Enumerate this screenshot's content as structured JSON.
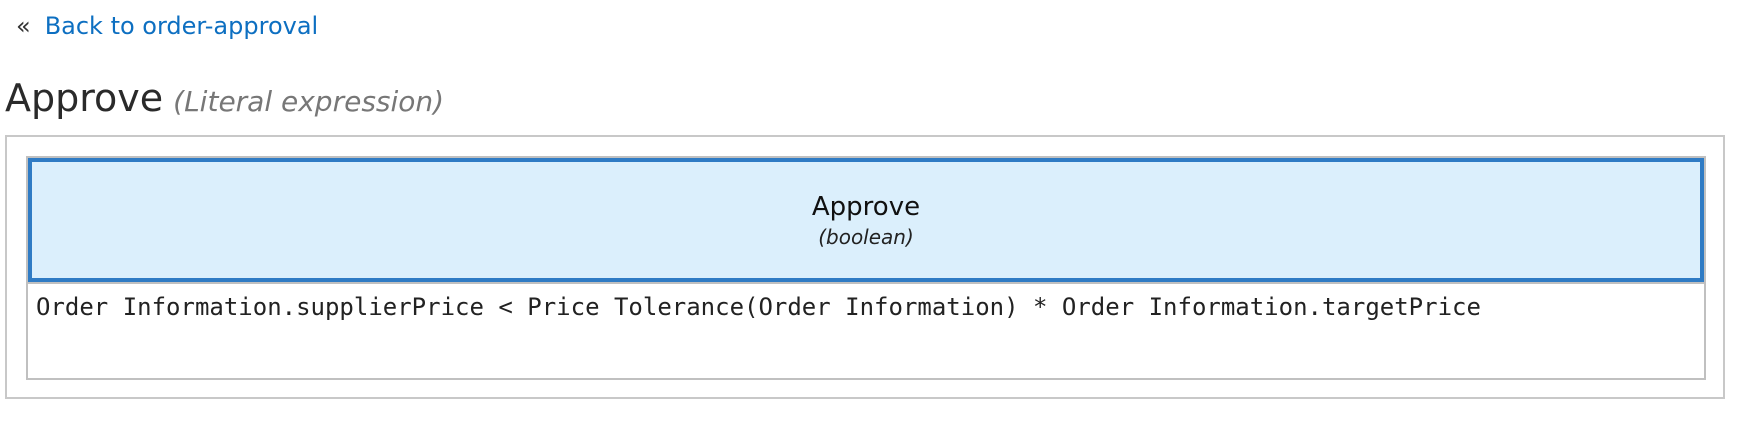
{
  "nav": {
    "back_icon": "«",
    "back_icon_name": "double-chevron-left-icon",
    "back_label": "Back to order-approval"
  },
  "heading": {
    "title": "Approve",
    "subtitle": "(Literal expression)"
  },
  "decision": {
    "name": "Approve",
    "type": "(boolean)",
    "expression": "Order Information.supplierPrice < Price Tolerance(Order Information) * Order Information.targetPrice"
  },
  "colors": {
    "link": "#0d6fc1",
    "header_fill": "#dbeffc",
    "header_border": "#2f7bc4"
  }
}
